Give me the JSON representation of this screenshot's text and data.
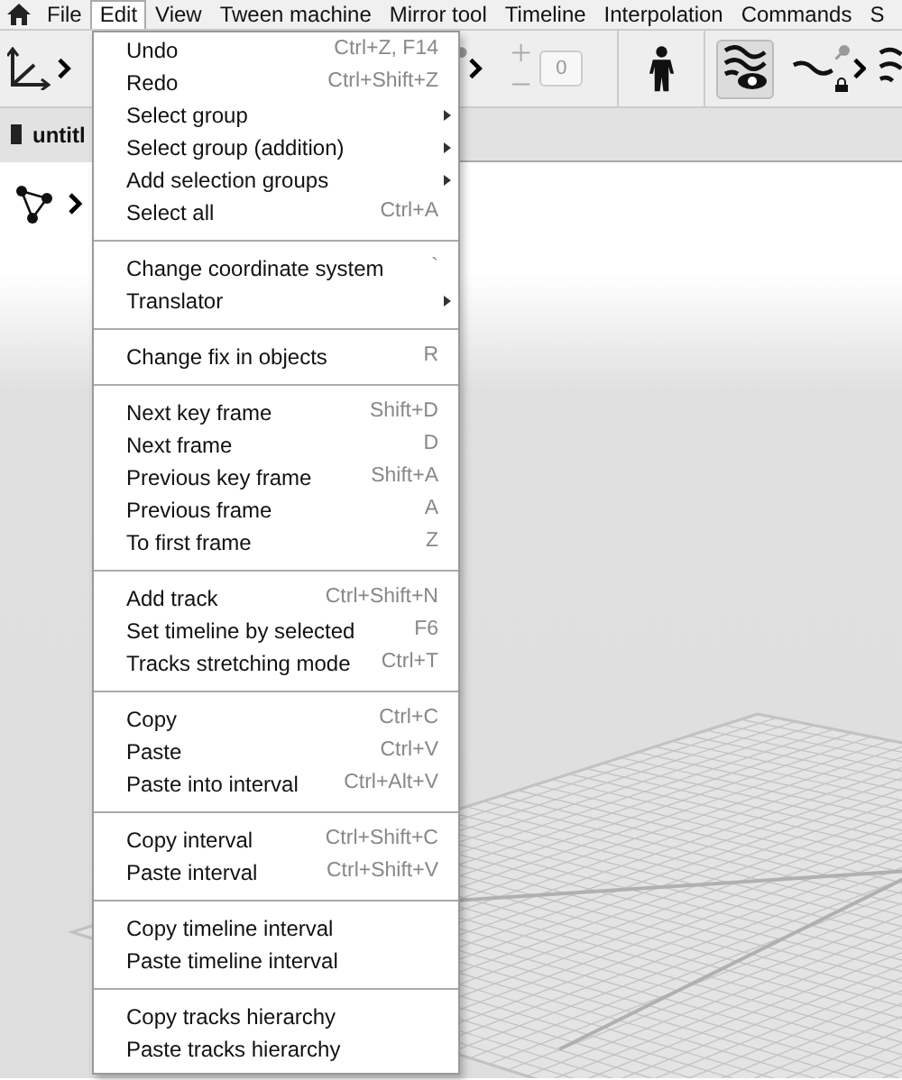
{
  "menubar": {
    "items": [
      {
        "label": "File",
        "selected": false
      },
      {
        "label": "Edit",
        "selected": true
      },
      {
        "label": "View",
        "selected": false
      },
      {
        "label": "Tween machine",
        "selected": false
      },
      {
        "label": "Mirror tool",
        "selected": false
      },
      {
        "label": "Timeline",
        "selected": false
      },
      {
        "label": "Interpolation",
        "selected": false
      },
      {
        "label": "Commands",
        "selected": false
      },
      {
        "label": "S",
        "selected": false
      }
    ]
  },
  "toolbar": {
    "counter": "0",
    "visibility_toggle": {
      "selected": true
    }
  },
  "tabs": [
    {
      "label": "untitl",
      "selected": true
    }
  ],
  "edit_menu": {
    "groups": [
      {
        "items": [
          {
            "label": "Undo",
            "shortcut": "Ctrl+Z, F14",
            "submenu": false
          },
          {
            "label": "Redo",
            "shortcut": "Ctrl+Shift+Z",
            "submenu": false
          },
          {
            "label": "Select group",
            "submenu": true
          },
          {
            "label": "Select group (addition)",
            "submenu": true
          },
          {
            "label": "Add selection groups",
            "submenu": true
          },
          {
            "label": "Select all",
            "shortcut": "Ctrl+A",
            "submenu": false
          }
        ]
      },
      {
        "items": [
          {
            "label": "Change coordinate system",
            "shortcut": "`",
            "submenu": false
          },
          {
            "label": "Translator",
            "submenu": true
          }
        ]
      },
      {
        "items": [
          {
            "label": "Change fix in objects",
            "shortcut": "R",
            "submenu": false
          }
        ]
      },
      {
        "items": [
          {
            "label": "Next key frame",
            "shortcut": "Shift+D",
            "submenu": false
          },
          {
            "label": "Next frame",
            "shortcut": "D",
            "submenu": false
          },
          {
            "label": "Previous key frame",
            "shortcut": "Shift+A",
            "submenu": false
          },
          {
            "label": "Previous frame",
            "shortcut": "A",
            "submenu": false
          },
          {
            "label": "To first frame",
            "shortcut": "Z",
            "submenu": false
          }
        ]
      },
      {
        "items": [
          {
            "label": "Add track",
            "shortcut": "Ctrl+Shift+N",
            "submenu": false
          },
          {
            "label": "Set timeline by selected",
            "shortcut": "F6",
            "submenu": false
          },
          {
            "label": "Tracks stretching mode",
            "shortcut": "Ctrl+T",
            "submenu": false
          }
        ]
      },
      {
        "items": [
          {
            "label": "Copy",
            "shortcut": "Ctrl+C",
            "submenu": false
          },
          {
            "label": "Paste",
            "shortcut": "Ctrl+V",
            "submenu": false
          },
          {
            "label": "Paste into interval",
            "shortcut": "Ctrl+Alt+V",
            "submenu": false
          }
        ]
      },
      {
        "items": [
          {
            "label": "Copy interval",
            "shortcut": "Ctrl+Shift+C",
            "submenu": false
          },
          {
            "label": "Paste interval",
            "shortcut": "Ctrl+Shift+V",
            "submenu": false
          }
        ]
      },
      {
        "items": [
          {
            "label": "Copy timeline interval",
            "submenu": false
          },
          {
            "label": "Paste timeline interval",
            "submenu": false
          }
        ]
      },
      {
        "items": [
          {
            "label": "Copy tracks hierarchy",
            "submenu": false
          },
          {
            "label": "Paste tracks hierarchy",
            "submenu": false
          }
        ]
      }
    ]
  }
}
